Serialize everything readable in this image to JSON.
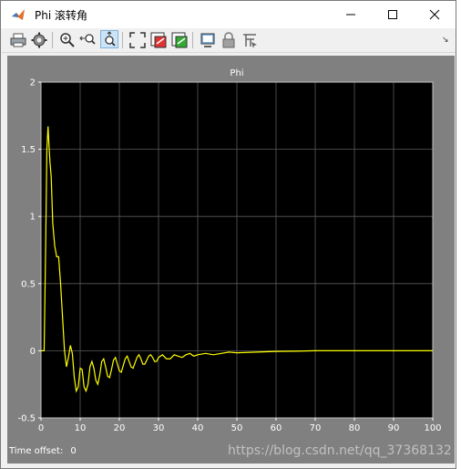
{
  "window": {
    "title": "Phi 滚转角",
    "controls": {
      "minimize": "—",
      "maximize": "☐",
      "close": "✕"
    }
  },
  "toolbar": {
    "items": [
      {
        "name": "print",
        "icon": "printer-icon"
      },
      {
        "name": "parameters",
        "icon": "gear-icon"
      },
      {
        "name": "zoom-in",
        "icon": "zoom-in-icon"
      },
      {
        "name": "zoom-x",
        "icon": "zoom-x-icon"
      },
      {
        "name": "zoom-y",
        "icon": "zoom-y-icon",
        "active": true
      },
      {
        "name": "autoscale",
        "icon": "autoscale-icon"
      },
      {
        "name": "save-axes-settings",
        "icon": "save-axes-icon"
      },
      {
        "name": "restore-axes-settings",
        "icon": "restore-axes-icon"
      },
      {
        "name": "floating-scope",
        "icon": "floating-scope-icon"
      },
      {
        "name": "lock-axes",
        "icon": "lock-icon"
      },
      {
        "name": "signal-selection",
        "icon": "signal-selection-icon"
      }
    ],
    "dock_arrow": "↘"
  },
  "scope": {
    "time_offset_label": "Time offset:",
    "time_offset_value": "0"
  },
  "watermark": "https://blog.csdn.net/qq_37368132",
  "colors": {
    "figure_bg": "#808080",
    "axes_bg": "#000000",
    "grid": "#5a5a5a",
    "line": "#ffff00",
    "axis_text": "#ffffff"
  },
  "chart_data": {
    "type": "line",
    "title": "Phi",
    "xlabel": "",
    "ylabel": "",
    "xlim": [
      0,
      100
    ],
    "ylim": [
      -0.5,
      2
    ],
    "xticks": [
      0,
      10,
      20,
      30,
      40,
      50,
      60,
      70,
      80,
      90,
      100
    ],
    "yticks": [
      -0.5,
      0,
      0.5,
      1,
      1.5,
      2
    ],
    "xtick_labels": [
      "0",
      "10",
      "20",
      "30",
      "40",
      "50",
      "60",
      "70",
      "80",
      "90",
      "100"
    ],
    "ytick_labels": [
      "-0.5",
      "0",
      "0.5",
      "1",
      "1.5",
      "2"
    ],
    "grid": true,
    "series": [
      {
        "x": [
          0,
          0.8,
          1.2,
          1.5,
          1.8,
          2.0,
          2.3,
          2.6,
          3.0,
          3.5,
          4.0,
          4.5,
          5.0,
          5.5,
          6.0,
          6.5,
          7.0,
          7.5,
          8.0,
          8.5,
          9.0,
          9.5,
          10.0,
          10.5,
          11.0,
          11.5,
          12.0,
          12.5,
          13.0,
          13.5,
          14.0,
          14.5,
          15.0,
          15.5,
          16.0,
          16.5,
          17.0,
          17.5,
          18.0,
          18.5,
          19.0,
          19.5,
          20.0,
          20.5,
          21.0,
          21.5,
          22.0,
          22.5,
          23.0,
          23.5,
          24.0,
          24.5,
          25.0,
          25.5,
          26.0,
          26.5,
          27.0,
          27.5,
          28.0,
          28.5,
          29.0,
          29.5,
          30.0,
          31.0,
          32.0,
          33.0,
          34.0,
          35.0,
          36.0,
          37.0,
          38.0,
          39.0,
          40.0,
          42.0,
          44.0,
          46.0,
          48.0,
          50.0,
          55.0,
          60.0,
          65.0,
          70.0,
          80.0,
          90.0,
          100.0
        ],
        "y": [
          0,
          0,
          0.8,
          1.5,
          1.67,
          1.55,
          1.4,
          1.3,
          0.95,
          0.78,
          0.7,
          0.7,
          0.5,
          0.25,
          0.0,
          -0.12,
          -0.05,
          0.04,
          -0.02,
          -0.2,
          -0.3,
          -0.27,
          -0.13,
          -0.14,
          -0.27,
          -0.3,
          -0.25,
          -0.12,
          -0.08,
          -0.13,
          -0.22,
          -0.25,
          -0.18,
          -0.08,
          -0.06,
          -0.12,
          -0.19,
          -0.2,
          -0.14,
          -0.07,
          -0.05,
          -0.1,
          -0.15,
          -0.16,
          -0.11,
          -0.06,
          -0.04,
          -0.08,
          -0.12,
          -0.13,
          -0.09,
          -0.05,
          -0.03,
          -0.06,
          -0.1,
          -0.1,
          -0.07,
          -0.04,
          -0.03,
          -0.05,
          -0.08,
          -0.08,
          -0.05,
          -0.03,
          -0.06,
          -0.06,
          -0.03,
          -0.04,
          -0.05,
          -0.03,
          -0.02,
          -0.04,
          -0.03,
          -0.02,
          -0.03,
          -0.02,
          -0.01,
          -0.015,
          -0.01,
          -0.005,
          -0.003,
          0,
          0,
          0,
          0
        ]
      }
    ]
  }
}
